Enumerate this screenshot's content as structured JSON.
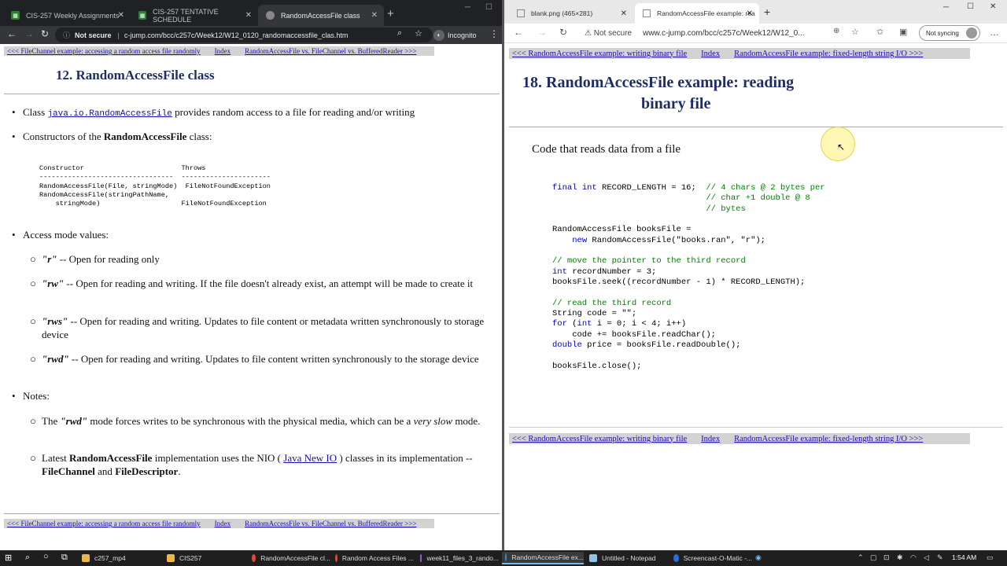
{
  "left": {
    "tabs": [
      {
        "label": "CIS-257 Weekly Assignments",
        "active": false
      },
      {
        "label": "CIS-257 TENTATIVE SCHEDULE",
        "active": false
      },
      {
        "label": "RandomAccessFile class",
        "active": true
      }
    ],
    "address": {
      "security": "Not secure",
      "url": "c-jump.com/bcc/c257c/Week12/W12_0120_randomaccessfile_clas.htm"
    },
    "incognito_label": "Incognito",
    "nav": {
      "prev": "<<< FileChannel example: accessing a random access file randomly",
      "index": "Index",
      "next": "RandomAccessFile vs. FileChannel vs. BufferedReader >>>"
    },
    "title": "12. RandomAccessFile class",
    "bullet1_pre": "Class ",
    "bullet1_code": "java.io.RandomAccessFile",
    "bullet1_post": " provides random access to a file for reading and/or writing",
    "bullet2_pre": "Constructors of the ",
    "bullet2_bold": "RandomAccessFile",
    "bullet2_post": " class:",
    "ctor_table": "Constructor                        Throws\n---------------------------------  ----------------------\nRandomAccessFile(File, stringMode)  FileNotFoundException\nRandomAccessFile(stringPathName,\n    stringMode)                    FileNotFoundException",
    "bullet3": "Access mode values:",
    "modes": [
      {
        "mode": "\"r\"",
        "desc": " -- Open for reading only"
      },
      {
        "mode": "\"rw\"",
        "desc": " -- Open for reading and writing. If the file doesn't already exist, an attempt will be made to create it"
      },
      {
        "mode": "\"rws\"",
        "desc": " -- Open for reading and writing. Updates to file content or metadata written synchronously to storage device"
      },
      {
        "mode": "\"rwd\"",
        "desc": " -- Open for reading and writing. Updates to file content written synchronously to the storage device"
      }
    ],
    "bullet4": "Notes:",
    "note1_pre": "The ",
    "note1_mode": "\"rwd\"",
    "note1_mid": " mode forces writes to be synchronous with the physical media, which can be a ",
    "note1_em": "very slow",
    "note1_post": " mode.",
    "note2_pre": "Latest ",
    "note2_bold": "RandomAccessFile",
    "note2_mid": " implementation uses the NIO ( ",
    "note2_link": "Java New IO",
    "note2_mid2": " ) classes in its implementation -- ",
    "note2_b1": "FileChannel",
    "note2_and": " and ",
    "note2_b2": "FileDescriptor",
    "note2_end": "."
  },
  "right": {
    "tabs": [
      {
        "label": "blank.png (465×281)",
        "active": false
      },
      {
        "label": "RandomAccessFile example: rea",
        "active": true
      }
    ],
    "address": {
      "security": "Not secure",
      "url": "www.c-jump.com/bcc/c257c/Week12/W12_0..."
    },
    "sync_label": "Not syncing",
    "nav": {
      "prev": "<<< RandomAccessFile example: writing binary file",
      "index": "Index",
      "next": "RandomAccessFile example: fixed-length string I/O >>>"
    },
    "title_line1": "18. RandomAccessFile example: reading",
    "title_line2": "binary file",
    "subtitle": "Code that reads data from a file"
  },
  "taskbar": {
    "items": [
      "c257_mp4",
      "CIS257",
      "RandomAccessFile cl...",
      "Random Access Files ...",
      "week11_files_3_rando...",
      "RandomAccessFile ex...",
      "Untitled - Notepad",
      "Screencast-O-Matic -..."
    ],
    "clock": "1:54 AM"
  },
  "colors": {
    "title": "#1e2e64",
    "link": "#1a0dab",
    "keyword": "#0000cc",
    "comment": "#008000",
    "navbar_bg": "#d3d3d3"
  }
}
